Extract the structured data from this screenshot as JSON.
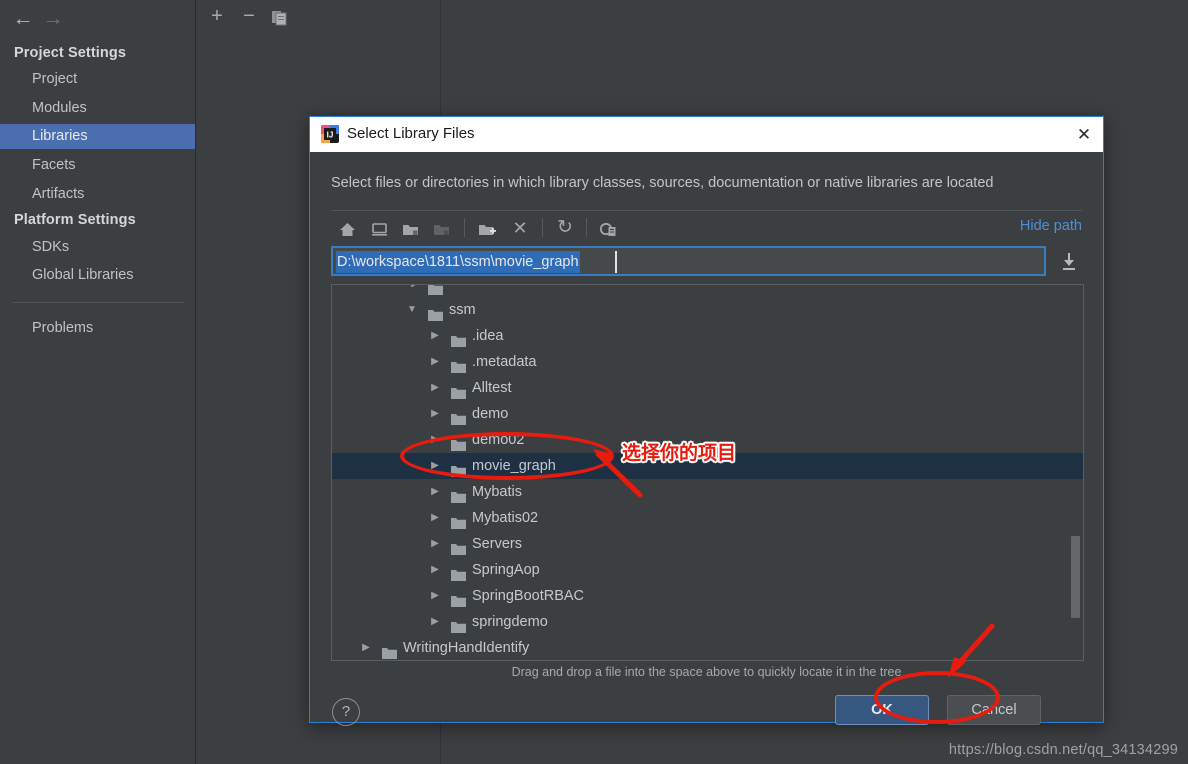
{
  "ide": {
    "nav": {
      "back_icon": "arrow-left-icon",
      "forward_icon": "arrow-right-icon"
    },
    "sidebar": {
      "groups": [
        {
          "title": "Project Settings",
          "items": [
            "Project",
            "Modules",
            "Libraries",
            "Facets",
            "Artifacts"
          ],
          "selected": "Libraries"
        },
        {
          "title": "Platform Settings",
          "items": [
            "SDKs",
            "Global Libraries"
          ]
        }
      ],
      "extra_items": [
        "Problems"
      ]
    },
    "toolbar": {
      "add_label": "+",
      "remove_label": "−",
      "copy_label": "copy-icon"
    },
    "watermark": "https://blog.csdn.net/qq_34134299"
  },
  "dialog": {
    "title": "Select Library Files",
    "logo_name": "intellij-idea-logo",
    "close_label": "✕",
    "subtitle": "Select files or directories in which library classes, sources, documentation or native libraries are located",
    "toolbar": {
      "icons": [
        {
          "name": "home-icon",
          "glyph": "⌂"
        },
        {
          "name": "desktop-icon",
          "glyph": "▭"
        },
        {
          "name": "project-folder-icon",
          "glyph": "folder"
        },
        {
          "name": "module-folder-icon",
          "glyph": "folder"
        },
        {
          "name": "new-folder-icon",
          "glyph": "folder-plus"
        },
        {
          "name": "delete-icon",
          "glyph": "✕"
        },
        {
          "name": "refresh-icon",
          "glyph": "↻"
        },
        {
          "name": "show-hidden-icon",
          "glyph": "eye-list"
        }
      ],
      "hide_path_label": "Hide path"
    },
    "path_field": {
      "value": "D:\\workspace\\1811\\ssm\\movie_graph",
      "placeholder": "",
      "selected": true,
      "download_icon": "download-icon"
    },
    "tree": {
      "rows": [
        {
          "label": "",
          "depth": 2,
          "partial": true,
          "expanded": false,
          "selected": false
        },
        {
          "label": "ssm",
          "depth": 1,
          "expanded": true,
          "selected": false
        },
        {
          "label": ".idea",
          "depth": 2,
          "expanded": false,
          "selected": false
        },
        {
          "label": ".metadata",
          "depth": 2,
          "expanded": false,
          "selected": false
        },
        {
          "label": "Alltest",
          "depth": 2,
          "expanded": false,
          "selected": false
        },
        {
          "label": "demo",
          "depth": 2,
          "expanded": false,
          "selected": false
        },
        {
          "label": "demo02",
          "depth": 2,
          "expanded": false,
          "selected": false
        },
        {
          "label": "movie_graph",
          "depth": 2,
          "expanded": false,
          "selected": true
        },
        {
          "label": "Mybatis",
          "depth": 2,
          "expanded": false,
          "selected": false
        },
        {
          "label": "Mybatis02",
          "depth": 2,
          "expanded": false,
          "selected": false
        },
        {
          "label": "Servers",
          "depth": 2,
          "expanded": false,
          "selected": false
        },
        {
          "label": "SpringAop",
          "depth": 2,
          "expanded": false,
          "selected": false
        },
        {
          "label": "SpringBootRBAC",
          "depth": 2,
          "expanded": false,
          "selected": false
        },
        {
          "label": "springdemo",
          "depth": 2,
          "expanded": false,
          "selected": false
        },
        {
          "label": "WritingHandIdentify",
          "depth": 1,
          "expanded": false,
          "selected": false
        }
      ]
    },
    "hint": "Drag and drop a file into the space above to quickly locate it in the tree",
    "buttons": {
      "help_label": "?",
      "ok_label": "OK",
      "cancel_label": "Cancel"
    }
  },
  "annotations": {
    "select_project_text": "选择你的项目",
    "accent_color": "#e81b0f"
  }
}
